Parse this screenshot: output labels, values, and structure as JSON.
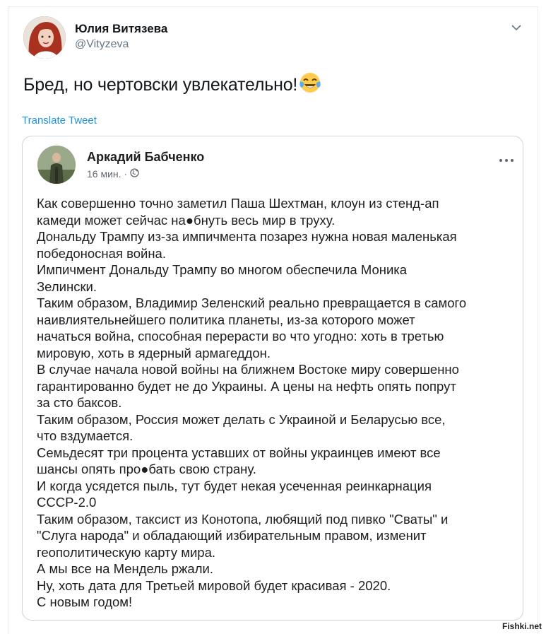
{
  "tweet": {
    "author_name": "Юлия Витязева",
    "author_handle": "@Vityzeva",
    "text": "Бред, но чертовски увлекательно!",
    "emoji": "tears-of-joy-emoji",
    "translate_label": "Translate Tweet"
  },
  "quoted_post": {
    "author_name": "Аркадий Бабченко",
    "time": "16 мин.",
    "separator": "·",
    "privacy_icon": "globe-icon",
    "lines": [
      "Как совершенно точно заметил Паша Шехтман, клоун из стенд-ап",
      "камеди может сейчас на●бнуть весь мир в труху.",
      "Дональду Трампу из-за импичмента позарез нужна новая маленькая",
      "победоносная война.",
      "Импичмент Дональду Трампу во многом обеспечила Моника",
      "Зелински.",
      "Таким образом, Владимир Зеленский реально превращается в самого",
      "наивлиятельнейшего политика планеты, из-за которого может",
      "начаться война, способная перерасти во что угодно: хоть в третью",
      "мировую, хоть в ядерный армагеддон.",
      "В случае начала новой войны на ближнем Востоке миру совершенно",
      "гарантированно будет не до Украины. А цены на нефть опять попрут",
      "за сто баксов.",
      "Таким образом, Россия может делать с Украиной и Беларусью все,",
      "что вздумается.",
      "Семьдесят три процента уставших от войны украинцев имеют все",
      "шансы опять про●бать свою страну.",
      "И когда усядется пыль, тут будет некая усеченная реинкарнация",
      "СССР-2.0",
      "Таким образом, таксист из Конотопа, любящий под пивко \"Сваты\" и",
      "\"Слуга народа\" и обладающий избирательным правом, изменит",
      "геополитическую карту мира.",
      "А мы все на Мендель ржали.",
      "Ну, хоть дата для Третьей мировой будет красивая - 2020.",
      "С новым годом!"
    ]
  },
  "watermark": "Fishki.net",
  "colors": {
    "handle": "#657786",
    "link": "#1b95e0",
    "border": "#ccd6dd",
    "text": "#14171a"
  }
}
